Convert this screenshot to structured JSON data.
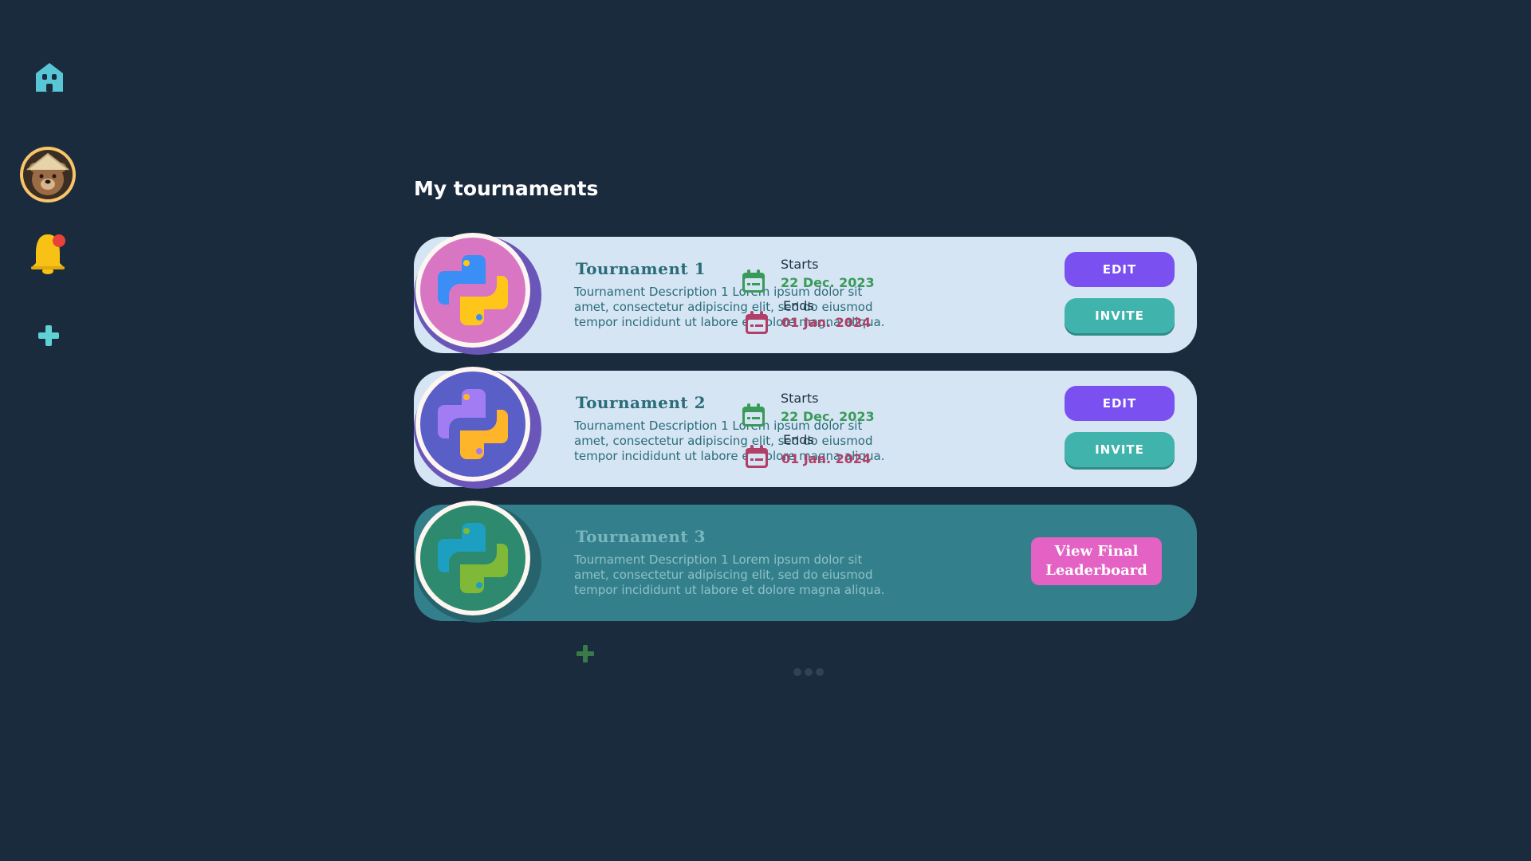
{
  "page": {
    "title": "My tournaments"
  },
  "sidebar": {
    "items": [
      {
        "icon": "home-icon"
      },
      {
        "icon": "bear-avatar-icon"
      },
      {
        "icon": "bell-icon",
        "badge": true
      },
      {
        "icon": "plus-icon"
      }
    ]
  },
  "tournaments": [
    {
      "title": "Tournament 1",
      "description": "Tournament Description 1 Lorem ipsum dolor sit amet, consectetur adipiscing elit, sed do eiusmod tempor incididunt ut labore et dolore magna aliqua.",
      "starts_label": "Starts",
      "starts_date": "22 Dec. 2023",
      "ends_label": "Ends",
      "ends_date": "01 Jan. 2024",
      "edit_label": "EDIT",
      "invite_label": "INVITE",
      "logo_bg": "#d876c4",
      "logo_colors": [
        "#3a8ef6",
        "#ffc61a"
      ]
    },
    {
      "title": "Tournament 2",
      "description": "Tournament Description 1 Lorem ipsum dolor sit amet, consectetur adipiscing elit, sed do eiusmod tempor incididunt ut labore et dolore magna aliqua.",
      "starts_label": "Starts",
      "starts_date": "22 Dec. 2023",
      "ends_label": "Ends",
      "ends_date": "01 Jan. 2024",
      "edit_label": "EDIT",
      "invite_label": "INVITE",
      "logo_bg": "#5a5fc8",
      "logo_colors": [
        "#a27cf4",
        "#ffb52a"
      ]
    },
    {
      "title": "Tournament 3",
      "description": "Tournament Description 1 Lorem ipsum dolor sit amet, consectetur adipiscing elit, sed do eiusmod tempor incididunt ut labore et dolore magna aliqua.",
      "leaderboard_line1": "View Final",
      "leaderboard_line2": "Leaderboard",
      "logo_bg": "#2e8a6e",
      "logo_colors": [
        "#1c9fc0",
        "#80b838"
      ]
    }
  ],
  "colors": {
    "background": "#1b2b3e",
    "card_active": "#d6e5f4",
    "card_finished": "#33808c",
    "edit_button": "#7b50f0",
    "invite_button": "#40b4ac",
    "leaderboard_button": "#e362c4"
  }
}
